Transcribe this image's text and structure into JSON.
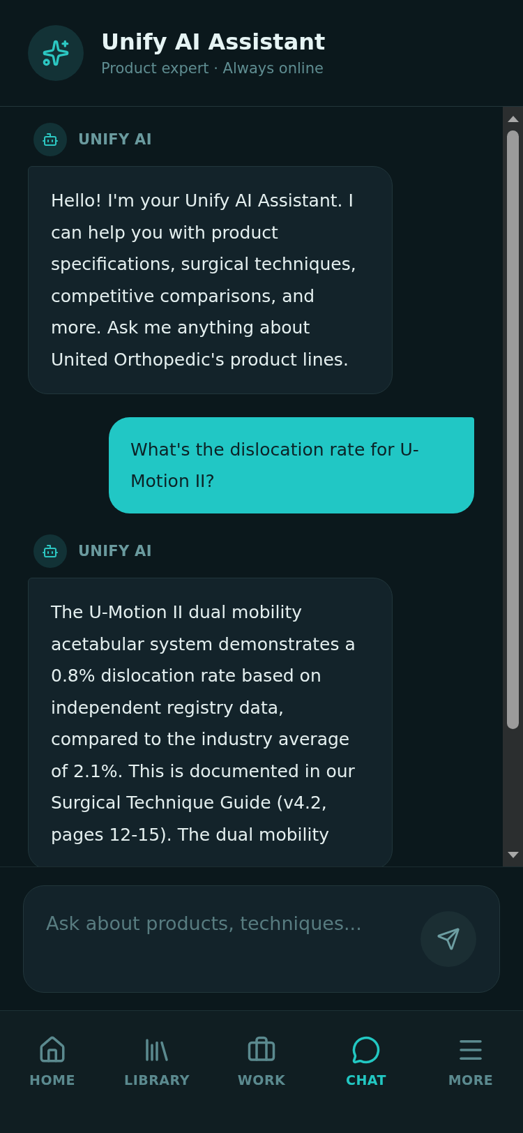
{
  "header": {
    "title": "Unify AI Assistant",
    "subtitle": "Product expert · Always online"
  },
  "messages": [
    {
      "kind": "bot",
      "label": "UNIFY AI",
      "text": "Hello! I'm your Unify AI Assistant. I can help you with product specifications, surgical techniques, competitive comparisons, and more. Ask me anything about United Orthopedic's product lines."
    },
    {
      "kind": "user",
      "text": "What's the dislocation rate for U-Motion II?"
    },
    {
      "kind": "bot",
      "label": "UNIFY AI",
      "text": "The U-Motion II dual mobility acetabular system demonstrates a 0.8% dislocation rate based on independent registry data, compared to the industry average of 2.1%. This is documented in our Surgical Technique Guide (v4.2, pages 12-15). The dual mobility"
    }
  ],
  "composer": {
    "placeholder": "Ask about products, techniques..."
  },
  "nav": [
    {
      "label": "HOME",
      "selected": false
    },
    {
      "label": "LIBRARY",
      "selected": false
    },
    {
      "label": "WORK",
      "selected": false
    },
    {
      "label": "CHAT",
      "selected": true
    },
    {
      "label": "MORE",
      "selected": false
    }
  ]
}
